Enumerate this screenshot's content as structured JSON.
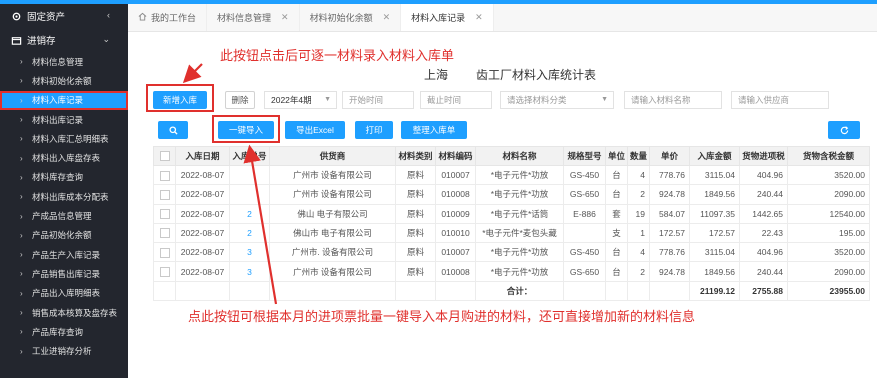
{
  "sidebar": {
    "groups": [
      {
        "label": "固定资产",
        "icon": "gear-icon",
        "chevron": "‹"
      },
      {
        "label": "进销存",
        "icon": "box-icon",
        "chevron": "⌄"
      }
    ],
    "items": [
      {
        "label": "材料信息管理"
      },
      {
        "label": "材料初始化余额"
      },
      {
        "label": "材料入库记录"
      },
      {
        "label": "材料出库记录"
      },
      {
        "label": "材料入库汇总明细表"
      },
      {
        "label": "材料出入库盘存表"
      },
      {
        "label": "材料库存查询"
      },
      {
        "label": "材料出库成本分配表"
      },
      {
        "label": "产成品信息管理"
      },
      {
        "label": "产品初始化余额"
      },
      {
        "label": "产品生产入库记录"
      },
      {
        "label": "产品销售出库记录"
      },
      {
        "label": "产品出入库明细表"
      },
      {
        "label": "销售成本核算及盘存表"
      },
      {
        "label": "产品库存查询"
      },
      {
        "label": "工业进销存分析"
      }
    ]
  },
  "tabs": [
    {
      "label": "我的工作台",
      "icon": "home-icon"
    },
    {
      "label": "材料信息管理"
    },
    {
      "label": "材料初始化余额"
    },
    {
      "label": "材料入库记录"
    }
  ],
  "title": {
    "prefix": "上海",
    "suffix": "齿工厂材料入库统计表"
  },
  "toolbar": {
    "add_label": "新增入库",
    "delete_label": "删除",
    "period": "2022年4期",
    "start_placeholder": "开始时间",
    "end_placeholder": "截止时间",
    "category_placeholder": "请选择材料分类",
    "name_placeholder": "请输入材料名称",
    "supplier_placeholder": "请输入供应商",
    "import_label": "一键导入",
    "export_label": "导出Excel",
    "print_label": "打印",
    "organize_label": "整理入库单"
  },
  "annotations": {
    "top": "此按钮点击后可逐一材料录入材料入库单",
    "bottom": "点此按钮可根据本月的进项票批量一键导入本月购进的材料，还可直接增加新的材料信息"
  },
  "table": {
    "headers": [
      "入库日期",
      "入库单号",
      "供货商",
      "材料类别",
      "材料编码",
      "材料名称",
      "规格型号",
      "单位",
      "数量",
      "单价",
      "入库金额",
      "货物进项税",
      "货物含税金额"
    ],
    "rows": [
      {
        "date": "2022-08-07",
        "no": "",
        "supplier": "广州市         设备有限公司",
        "cat": "原料",
        "code": "010007",
        "name": "*电子元件*功放",
        "spec": "GS-450",
        "unit": "台",
        "qty": "4",
        "price": "778.76",
        "amount": "3115.04",
        "tax": "404.96",
        "total": "3520.00"
      },
      {
        "date": "2022-08-07",
        "no": "",
        "supplier": "广州市         设备有限公司",
        "cat": "原料",
        "code": "010008",
        "name": "*电子元件*功放",
        "spec": "GS-650",
        "unit": "台",
        "qty": "2",
        "price": "924.78",
        "amount": "1849.56",
        "tax": "240.44",
        "total": "2090.00"
      },
      {
        "date": "2022-08-07",
        "no": "2",
        "supplier": "佛山        电子有限公司",
        "cat": "原料",
        "code": "010009",
        "name": "*电子元件*话筒",
        "spec": "E-886",
        "unit": "套",
        "qty": "19",
        "price": "584.07",
        "amount": "11097.35",
        "tax": "1442.65",
        "total": "12540.00"
      },
      {
        "date": "2022-08-07",
        "no": "2",
        "supplier": "佛山市    电子有限公司",
        "cat": "原料",
        "code": "010010",
        "name": "*电子元件*麦包头藏",
        "spec": "",
        "unit": "支",
        "qty": "1",
        "price": "172.57",
        "amount": "172.57",
        "tax": "22.43",
        "total": "195.00"
      },
      {
        "date": "2022-08-07",
        "no": "3",
        "supplier": "广州市.         设备有限公司",
        "cat": "原料",
        "code": "010007",
        "name": "*电子元件*功放",
        "spec": "GS-450",
        "unit": "台",
        "qty": "4",
        "price": "778.76",
        "amount": "3115.04",
        "tax": "404.96",
        "total": "3520.00"
      },
      {
        "date": "2022-08-07",
        "no": "3",
        "supplier": "广州市         设备有限公司",
        "cat": "原料",
        "code": "010008",
        "name": "*电子元件*功放",
        "spec": "GS-650",
        "unit": "台",
        "qty": "2",
        "price": "924.78",
        "amount": "1849.56",
        "tax": "240.44",
        "total": "2090.00"
      }
    ],
    "total": {
      "label": "合计：",
      "amount": "21199.12",
      "tax": "2755.88",
      "total": "23955.00"
    }
  },
  "colors": {
    "accent": "#1e9fff",
    "annotation": "#e0302d",
    "sidebar": "#23262e"
  }
}
